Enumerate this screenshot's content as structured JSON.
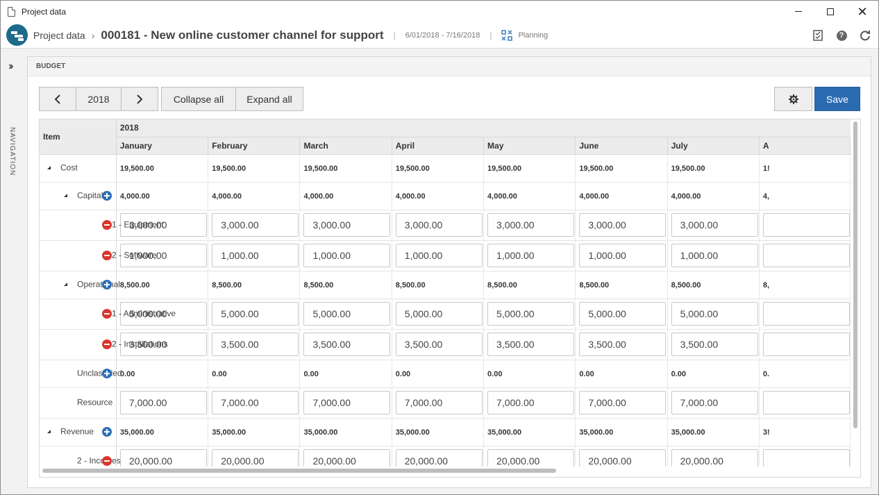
{
  "window": {
    "title": "Project data"
  },
  "header": {
    "breadcrumb_root": "Project data",
    "project_title": "000181 - New online customer channel for support",
    "dates": "6/01/2018 - 7/16/2018",
    "status": "Planning"
  },
  "nav": {
    "label": "NAVIGATION"
  },
  "panel": {
    "title": "BUDGET"
  },
  "toolbar": {
    "year": "2018",
    "collapse_all": "Collapse all",
    "expand_all": "Expand all",
    "save": "Save"
  },
  "grid": {
    "item_header": "Item",
    "year_header": "2018",
    "months": [
      "January",
      "February",
      "March",
      "April",
      "May",
      "June",
      "July",
      "A"
    ],
    "rows": [
      {
        "label": "Cost",
        "level": 0,
        "caret": true,
        "action": "",
        "type": "bold",
        "values": [
          "19,500.00",
          "19,500.00",
          "19,500.00",
          "19,500.00",
          "19,500.00",
          "19,500.00",
          "19,500.00",
          "1!"
        ]
      },
      {
        "label": "Capital",
        "level": 1,
        "caret": true,
        "action": "plus",
        "type": "bold",
        "values": [
          "4,000.00",
          "4,000.00",
          "4,000.00",
          "4,000.00",
          "4,000.00",
          "4,000.00",
          "4,000.00",
          "4,"
        ]
      },
      {
        "label": "1.1 - Equipment",
        "level": 2,
        "caret": false,
        "action": "minus",
        "type": "input",
        "values": [
          "3,000.00",
          "3,000.00",
          "3,000.00",
          "3,000.00",
          "3,000.00",
          "3,000.00",
          "3,000.00",
          ""
        ]
      },
      {
        "label": "1.2 - Software",
        "level": 2,
        "caret": false,
        "action": "minus",
        "type": "input",
        "values": [
          "1,000.00",
          "1,000.00",
          "1,000.00",
          "1,000.00",
          "1,000.00",
          "1,000.00",
          "1,000.00",
          ""
        ]
      },
      {
        "label": "Operational",
        "level": 1,
        "caret": true,
        "action": "plus",
        "type": "bold",
        "values": [
          "8,500.00",
          "8,500.00",
          "8,500.00",
          "8,500.00",
          "8,500.00",
          "8,500.00",
          "8,500.00",
          "8,"
        ]
      },
      {
        "label": "2.1 - Administrative",
        "level": 2,
        "caret": false,
        "action": "minus",
        "type": "input",
        "values": [
          "5,000.00",
          "5,000.00",
          "5,000.00",
          "5,000.00",
          "5,000.00",
          "5,000.00",
          "5,000.00",
          ""
        ]
      },
      {
        "label": "2.2 - Installations",
        "level": 2,
        "caret": false,
        "action": "minus",
        "type": "input",
        "values": [
          "3,500.00",
          "3,500.00",
          "3,500.00",
          "3,500.00",
          "3,500.00",
          "3,500.00",
          "3,500.00",
          ""
        ]
      },
      {
        "label": "Unclassified",
        "level": 1,
        "caret": false,
        "action": "plus",
        "type": "bold",
        "values": [
          "0.00",
          "0.00",
          "0.00",
          "0.00",
          "0.00",
          "0.00",
          "0.00",
          "0."
        ]
      },
      {
        "label": "Resource",
        "level": 1,
        "caret": false,
        "action": "",
        "type": "input",
        "values": [
          "7,000.00",
          "7,000.00",
          "7,000.00",
          "7,000.00",
          "7,000.00",
          "7,000.00",
          "7,000.00",
          ""
        ]
      },
      {
        "label": "Revenue",
        "level": 0,
        "caret": true,
        "action": "plus",
        "type": "bold",
        "values": [
          "35,000.00",
          "35,000.00",
          "35,000.00",
          "35,000.00",
          "35,000.00",
          "35,000.00",
          "35,000.00",
          "3!"
        ]
      },
      {
        "label": "2 - Incomes",
        "level": 1,
        "caret": false,
        "action": "minus",
        "type": "input",
        "values": [
          "20,000.00",
          "20,000.00",
          "20,000.00",
          "20,000.00",
          "20,000.00",
          "20,000.00",
          "20,000.00",
          ""
        ]
      }
    ]
  },
  "colors": {
    "brand": "#1d6b8a",
    "save": "#2a6bb0",
    "add": "#2e6fb5",
    "remove": "#d9362f"
  },
  "icons": [
    "document-icon",
    "minimize-icon",
    "maximize-icon",
    "close-icon",
    "logo-icon",
    "planning-icon",
    "checklist-icon",
    "help-icon",
    "refresh-icon",
    "chevron-right-double-icon",
    "chevron-left-icon",
    "chevron-right-icon",
    "gear-icon",
    "plus-circle-icon",
    "minus-circle-icon",
    "caret-icon"
  ]
}
